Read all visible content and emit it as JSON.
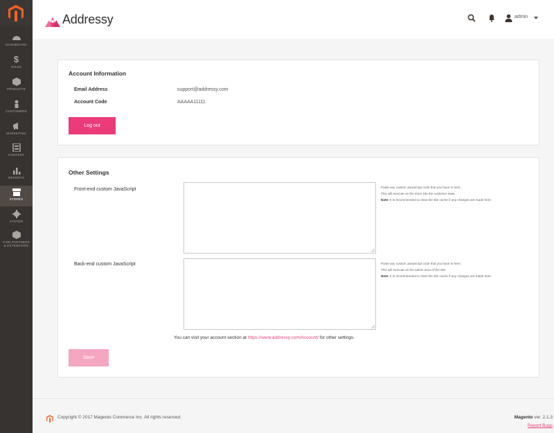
{
  "sidebar": {
    "items": [
      {
        "label": "DASHBOARD",
        "icon": "dashboard-icon"
      },
      {
        "label": "SALES",
        "icon": "dollar-icon"
      },
      {
        "label": "PRODUCTS",
        "icon": "box-icon"
      },
      {
        "label": "CUSTOMERS",
        "icon": "person-icon"
      },
      {
        "label": "MARKETING",
        "icon": "megaphone-icon"
      },
      {
        "label": "CONTENT",
        "icon": "layout-icon"
      },
      {
        "label": "REPORTS",
        "icon": "bar-chart-icon"
      },
      {
        "label": "STORES",
        "icon": "store-icon"
      },
      {
        "label": "SYSTEM",
        "icon": "gear-icon"
      },
      {
        "label": "FIND PARTNERS",
        "label2": "& EXTENSIONS",
        "icon": "cube-icon"
      }
    ],
    "active": "STORES"
  },
  "header": {
    "brand": "Addressy",
    "user": "admin"
  },
  "account": {
    "title": "Account Information",
    "email_label": "Email Address",
    "email_value": "support@addressy.com",
    "code_label": "Account Code",
    "code_value": "AAAAA11111",
    "logout_label": "Log out"
  },
  "settings": {
    "title": "Other Settings",
    "frontend_label": "Front-end custom JavaScript",
    "frontend_help1": "Paste any custom JavaScript code that you have in here.",
    "frontend_help2": "This will execute on the store site the customer sees.",
    "backend_label": "Back-end custom JavaScript",
    "backend_help1": "Paste any custom JavaScript code that you have in here.",
    "backend_help2": "This will execute on the admin area of the site.",
    "note_bold": "Note:",
    "note_text": " It is recommended to clear the site cache if any changes are made here.",
    "visit_prefix": "You can visit your account section at ",
    "visit_link": "https://www.addressy.com/Account/",
    "visit_suffix": " for other settings.",
    "save_label": "Save"
  },
  "footer": {
    "copyright": "Copyright © 2017 Magento Commerce Inc. All rights reserved.",
    "version_bold": "Magento",
    "version_text": " ver. 2.1.3",
    "report_bugs": "Report Bugs"
  },
  "colors": {
    "accent": "#eb3c79",
    "sidebar": "#373330",
    "magento_orange": "#f26322"
  }
}
